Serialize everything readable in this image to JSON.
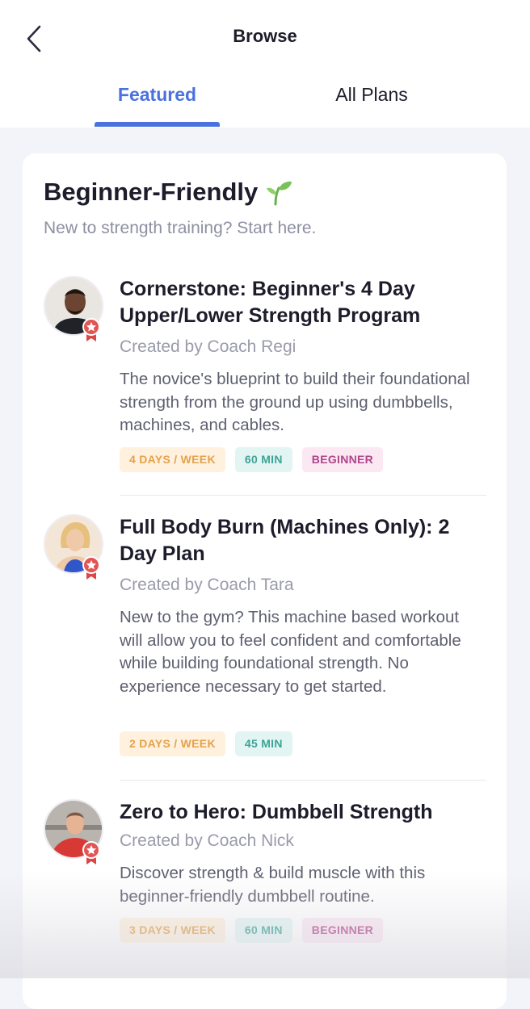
{
  "header": {
    "title": "Browse",
    "back_icon": "chevron-left-icon"
  },
  "tabs": [
    {
      "label": "Featured",
      "active": true
    },
    {
      "label": "All Plans",
      "active": false
    }
  ],
  "colors": {
    "accent": "#4a72de",
    "days_tag": "#e4a24d",
    "min_tag": "#3ea396",
    "level_tag": "#b0448a"
  },
  "section": {
    "title": "Beginner-Friendly",
    "title_icon": "seedling-icon",
    "subtitle": "New to strength training? Start here."
  },
  "plans": [
    {
      "title": "Cornerstone: Beginner's 4 Day Upper/Lower Strength Program",
      "coach": "Created by Coach Regi",
      "description": "The novice's blueprint to build their foundational strength from the ground up using dumbbells, machines, and cables.",
      "days": "4 DAYS / WEEK",
      "duration": "60 MIN",
      "level": "BEGINNER"
    },
    {
      "title": "Full Body Burn (Machines Only): 2 Day Plan",
      "coach": "Created by Coach Tara",
      "description": "New to the gym? This machine based workout will allow you to feel confident and comfortable while building foundational strength. No experience necessary to get started.",
      "days": "2 DAYS / WEEK",
      "duration": "45 MIN"
    },
    {
      "title": "Zero to Hero: Dumbbell Strength",
      "coach": "Created by Coach Nick",
      "description": "Discover strength & build muscle with this beginner-friendly dumbbell routine.",
      "days": "3 DAYS / WEEK",
      "duration": "60 MIN",
      "level": "BEGINNER"
    }
  ]
}
